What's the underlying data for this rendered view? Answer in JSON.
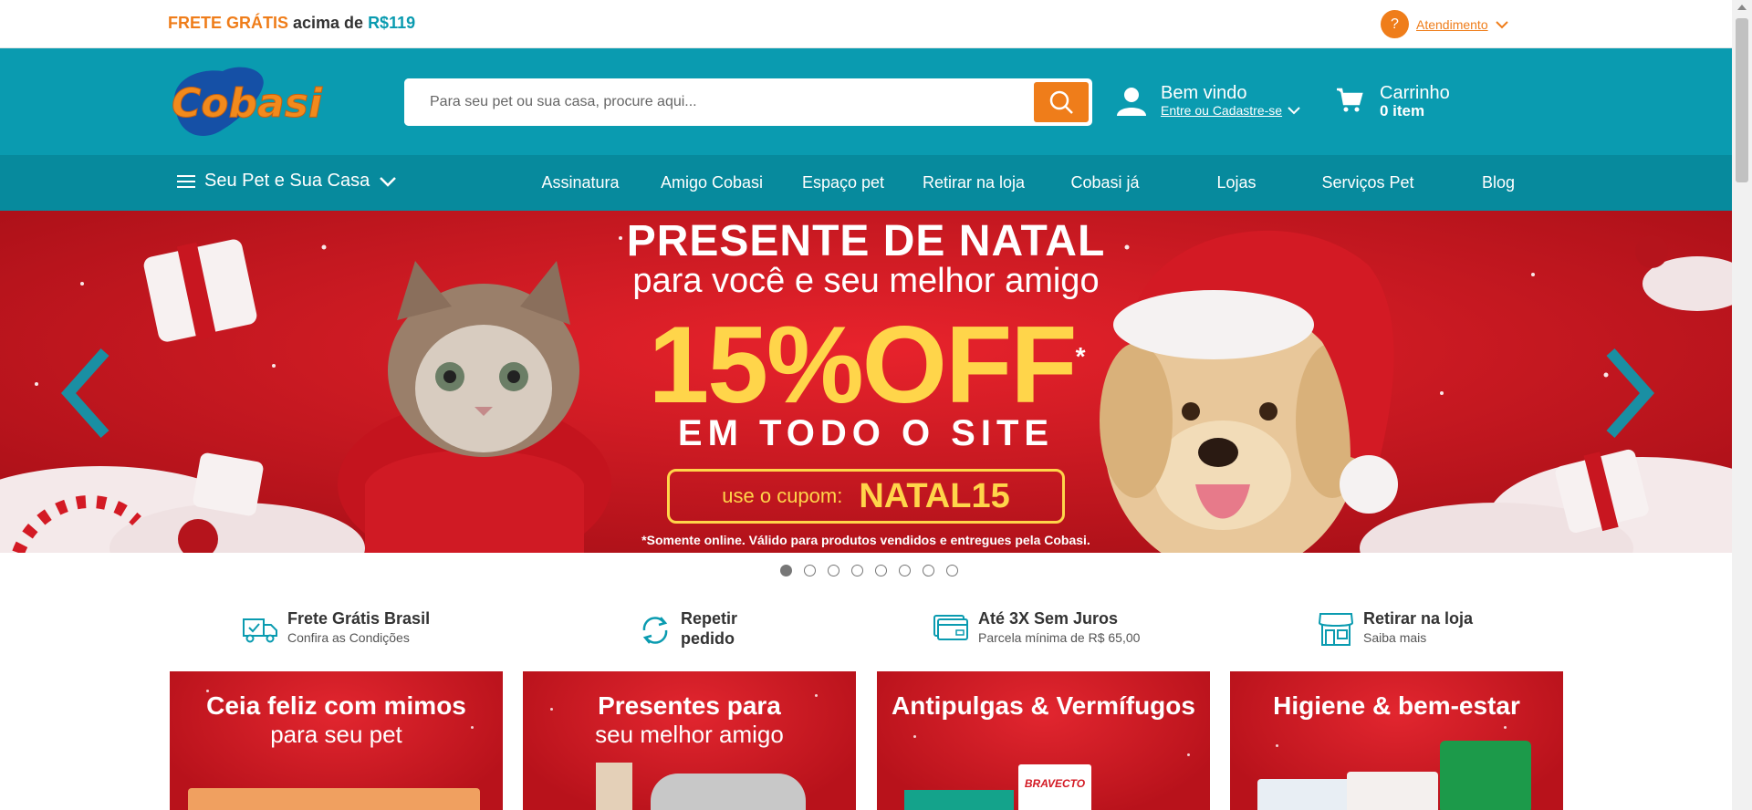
{
  "topbar": {
    "promo_part1": "FRETE GRÁTIS",
    "promo_part2": " acima de ",
    "promo_part3": "R$119",
    "help_icon": "?",
    "support_label": "Atendimento"
  },
  "header": {
    "logo_text": "Cobasi",
    "search_placeholder": "Para seu pet ou sua casa, procure aqui...",
    "user_greeting": "Bem vindo",
    "user_link": "Entre ou Cadastre-se",
    "cart_title": "Carrinho",
    "cart_count": "0 item"
  },
  "nav": {
    "category_label": "Seu Pet e Sua Casa",
    "items": [
      "Assinatura",
      "Amigo Cobasi",
      "Espaço pet",
      "Retirar na loja",
      "Cobasi já",
      "Lojas",
      "Serviços Pet",
      "Blog"
    ]
  },
  "banner": {
    "line1": "PRESENTE DE NATAL",
    "line2": "para você e seu melhor amigo",
    "discount": "15%OFF",
    "asterisk": "*",
    "line3": "EM TODO O SITE",
    "coupon_label": "use o cupom:",
    "coupon_code": "NATAL15",
    "fine_print": "*Somente online. Válido para produtos vendidos e entregues pela Cobasi.",
    "slide_count": 8,
    "active_slide": 1
  },
  "benefits": [
    {
      "title": "Frete Grátis Brasil",
      "subtitle": "Confira as Condições",
      "icon": "truck-icon"
    },
    {
      "title": "Repetir",
      "subtitle": "pedido",
      "icon": "repeat-icon"
    },
    {
      "title": "Até 3X Sem Juros",
      "subtitle": "Parcela mínima de R$ 65,00",
      "icon": "credit-card-icon"
    },
    {
      "title": "Retirar na loja",
      "subtitle": "Saiba mais",
      "icon": "store-icon"
    }
  ],
  "cards": [
    {
      "line1": "Ceia feliz com mimos",
      "line2": "para seu pet"
    },
    {
      "line1": "Presentes para",
      "line2": "seu melhor amigo"
    },
    {
      "line1": "Antipulgas & Vermífugos",
      "line2": "",
      "product_text": "BRAVECTO"
    },
    {
      "line1": "Higiene & bem-estar",
      "line2": ""
    }
  ],
  "colors": {
    "brand_teal": "#0a9bb0",
    "nav_teal": "#078a9d",
    "brand_orange": "#ef7d1a",
    "banner_red": "#d4161f",
    "offer_yellow": "#ffd54a"
  }
}
